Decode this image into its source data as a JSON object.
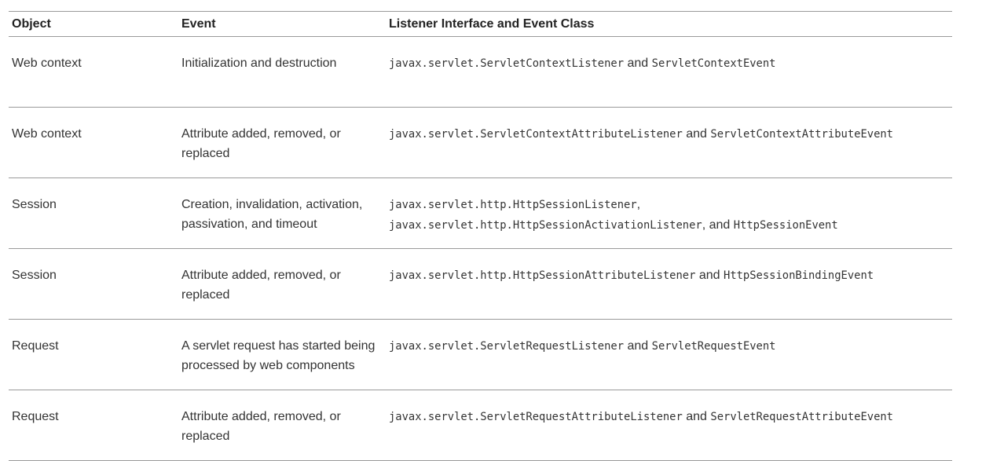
{
  "headers": {
    "object": "Object",
    "event": "Event",
    "listener": "Listener Interface and Event Class"
  },
  "connectors": {
    "and": "and",
    "comma": ",",
    "comma_and": ", and"
  },
  "rows": [
    {
      "object": "Web context",
      "event": "Initialization and destruction",
      "listener_class": "javax.servlet.ServletContextListener",
      "event_class": "ServletContextEvent"
    },
    {
      "object": "Web context",
      "event": "Attribute added, removed, or replaced",
      "listener_class": "javax.servlet.ServletContextAttributeListener",
      "event_class": "ServletContextAttributeEvent"
    },
    {
      "object": "Session",
      "event": "Creation, invalidation, activation, passivation, and timeout",
      "listener_class": "javax.servlet.http.HttpSessionListener",
      "listener_class_2": "javax.servlet.http.HttpSessionActivationListener",
      "event_class": "HttpSessionEvent"
    },
    {
      "object": "Session",
      "event": "Attribute added, removed, or replaced",
      "listener_class": "javax.servlet.http.HttpSessionAttributeListener",
      "event_class": "HttpSessionBindingEvent"
    },
    {
      "object": "Request",
      "event": "A servlet request has started being processed by web components",
      "listener_class": "javax.servlet.ServletRequestListener",
      "event_class": "ServletRequestEvent"
    },
    {
      "object": "Request",
      "event": "Attribute added, removed, or replaced",
      "listener_class": "javax.servlet.ServletRequestAttributeListener",
      "event_class": "ServletRequestAttributeEvent"
    }
  ]
}
